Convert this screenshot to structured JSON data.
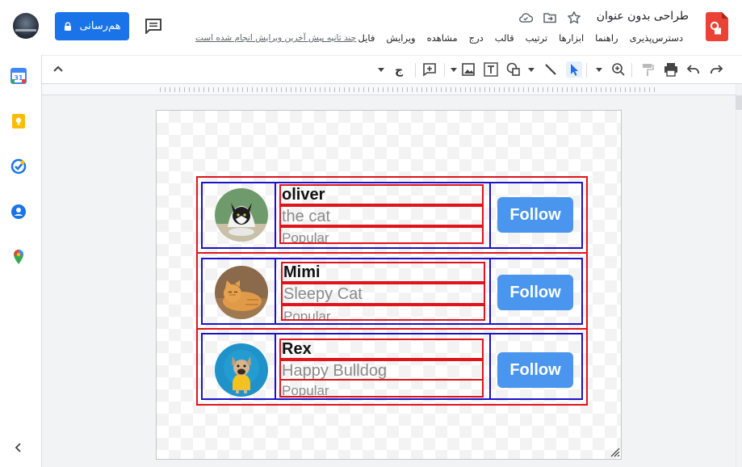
{
  "header": {
    "title": "طراحی بدون عنوان",
    "share_label": "هم‌رسانی",
    "last_edit": "چند ثانیه پیش آخرین ویرایش انجام شده است",
    "menu": [
      "فایل",
      "ویرایش",
      "مشاهده",
      "درج",
      "قالب",
      "ترتیب",
      "ابزارها",
      "راهنما",
      "دسترس‌پذیری"
    ]
  },
  "colors": {
    "accent": "#1a73e8",
    "follow_button": "#4a95ee",
    "outline_red": "#e0141b",
    "outline_blue": "#1c12c8"
  },
  "icons": {
    "app": "drawings-logo-icon",
    "toolbar": [
      "redo-icon",
      "undo-icon",
      "print-icon",
      "paint-format-icon",
      "zoom-icon",
      "select-icon",
      "line-icon",
      "shape-icon",
      "textbox-icon",
      "image-icon",
      "comment-add-icon",
      "input-tools-icon",
      "collapse-toolbar-icon"
    ],
    "side": [
      "calendar-icon",
      "keep-icon",
      "tasks-icon",
      "contacts-icon",
      "maps-icon",
      "expand-panel-icon"
    ]
  },
  "profiles": [
    {
      "name": "oliver",
      "description": "the cat",
      "tag": "Popular",
      "button": "Follow",
      "photo": "cat-portrait"
    },
    {
      "name": "Mimi",
      "description": "Sleepy Cat",
      "tag": "Popular",
      "button": "Follow",
      "photo": "orange-cat"
    },
    {
      "name": "Rex",
      "description": "Happy Bulldog",
      "tag": "Popular",
      "button": "Follow",
      "photo": "bulldog"
    }
  ]
}
